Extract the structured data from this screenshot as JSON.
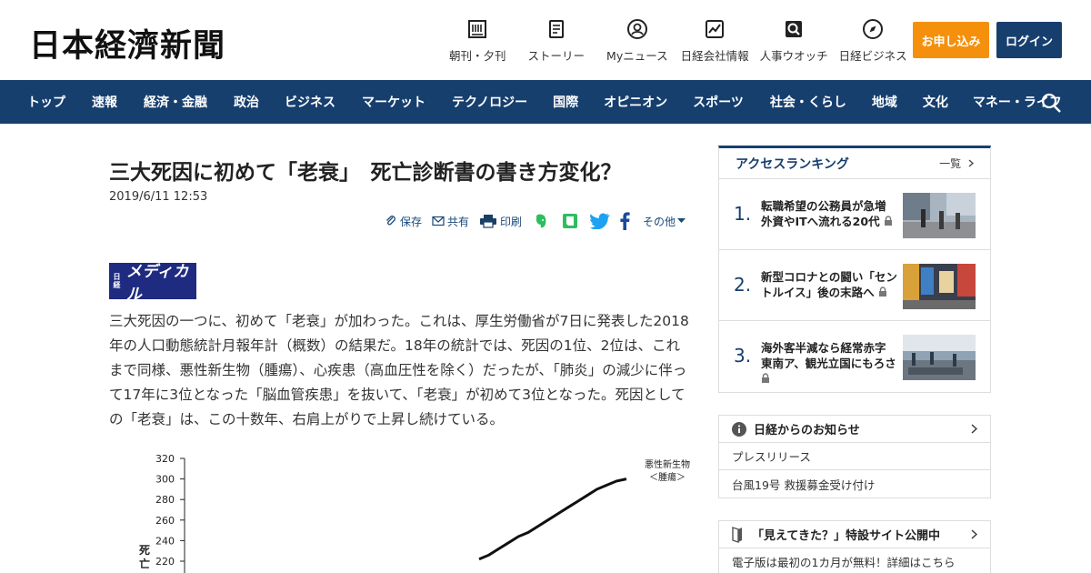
{
  "header": {
    "logo": "日本経濟新聞",
    "nav": [
      {
        "label": "朝刊・夕刊",
        "icon": "newspaper-icon"
      },
      {
        "label": "ストーリー",
        "icon": "story-icon"
      },
      {
        "label": "Myニュース",
        "icon": "user-icon"
      },
      {
        "label": "日経会社情報",
        "icon": "chart-icon"
      },
      {
        "label": "人事ウオッチ",
        "icon": "person-search-icon"
      },
      {
        "label": "日経ビジネス",
        "icon": "compass-icon"
      }
    ],
    "apply_label": "お申し込み",
    "login_label": "ログイン",
    "apply_color": "#f5900d",
    "login_color": "#173f6e"
  },
  "mainnav": {
    "color": "#163f6e",
    "items": [
      "トップ",
      "速報",
      "経済・金融",
      "政治",
      "ビジネス",
      "マーケット",
      "テクノロジー",
      "国際",
      "オピニオン",
      "スポーツ",
      "社会・くらし",
      "地域",
      "文化",
      "マネー・ライフ"
    ]
  },
  "article": {
    "title": "三大死因に初めて「老衰」　死亡診断書の書き方変化？",
    "date": "2019/6/11 12:53",
    "share": {
      "save": "保存",
      "share": "共有",
      "print": "印刷",
      "other": "その他"
    },
    "badge_small": "日経",
    "badge_big": "メディカル",
    "body": "三大死因の一つに、初めて「老衰」が加わった。これは、厚生労働省が7日に発表した2018年の人口動態統計月報年計（概数）の結果だ。18年の統計では、死因の1位、2位は、これまで同様、悪性新生物（腫瘍）、心疾患（高血圧性を除く）だったが、「肺炎」の減少に伴って17年に3位となった「脳血管疾患」を抜いて、「老衰」が初めて3位となった。死因としての「老衰」は、この十数年、右肩上がりで上昇し続けている。"
  },
  "chart_data": {
    "type": "line",
    "yticks": [
      320,
      300,
      280,
      260,
      240,
      220
    ],
    "ylabel": "死亡",
    "series": [
      {
        "name": "悪性新生物＜腫瘍＞",
        "points": [
          [
            0.6,
            222
          ],
          [
            0.62,
            226
          ],
          [
            0.64,
            232
          ],
          [
            0.66,
            238
          ],
          [
            0.68,
            244
          ],
          [
            0.7,
            248
          ],
          [
            0.72,
            254
          ],
          [
            0.74,
            260
          ],
          [
            0.76,
            266
          ],
          [
            0.78,
            272
          ],
          [
            0.8,
            278
          ],
          [
            0.82,
            284
          ],
          [
            0.84,
            290
          ],
          [
            0.86,
            294
          ],
          [
            0.88,
            298
          ],
          [
            0.9,
            300
          ]
        ]
      }
    ]
  },
  "sidebar": {
    "ranking": {
      "title": "アクセスランキング",
      "more": "一覧",
      "items": [
        {
          "rank": "1.",
          "text": "転職希望の公務員が急増 外資やITへ流れる20代"
        },
        {
          "rank": "2.",
          "text": "新型コロナとの闘い「セントルイス」後の末路へ"
        },
        {
          "rank": "3.",
          "text": "海外客半減なら経常赤字 東南ア、観光立国にもろさ"
        }
      ]
    },
    "notice": {
      "title": "日経からのお知らせ",
      "items": [
        "プレスリリース",
        "台風19号 救援募金受け付け"
      ]
    },
    "promo": {
      "title": "「見えてきた？」特設サイト公開中",
      "items": [
        "電子版は最初の1カ月が無料！詳細はこちら"
      ]
    }
  }
}
